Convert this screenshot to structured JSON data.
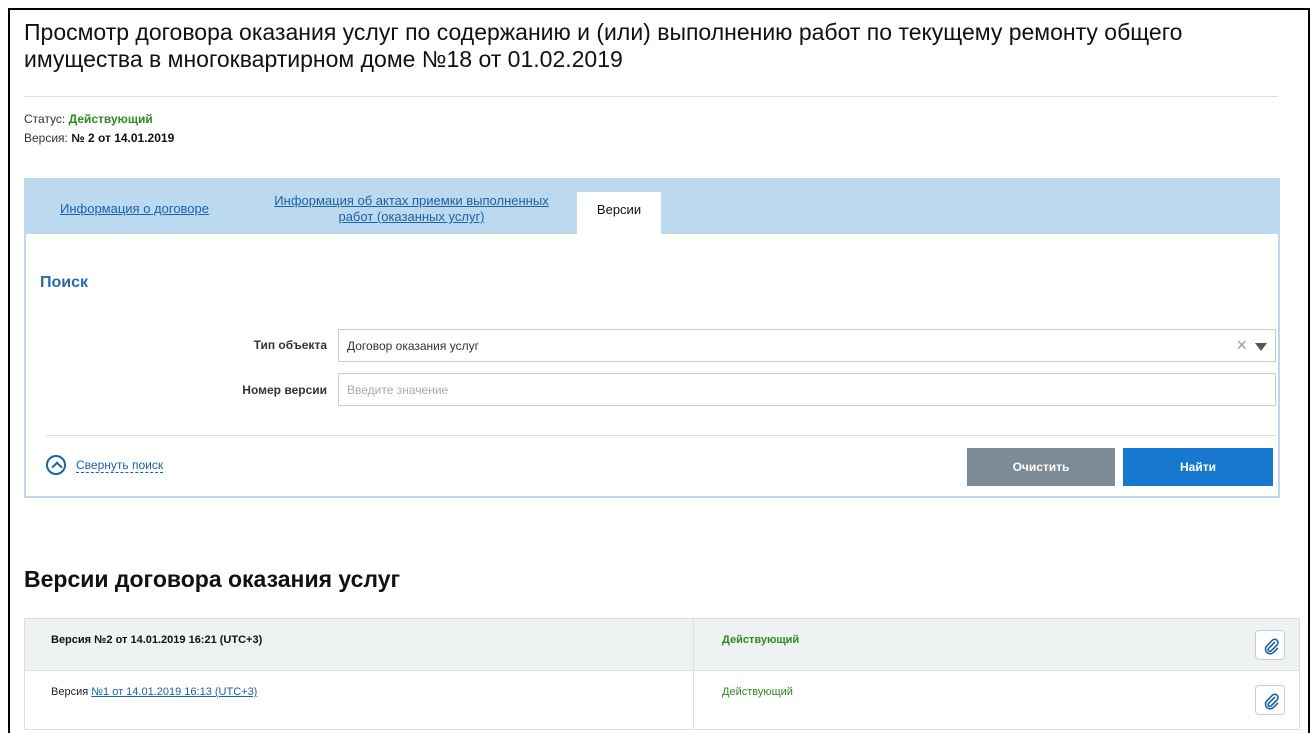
{
  "header": {
    "title": "Просмотр договора оказания услуг по содержанию и (или) выполнению работ по текущему ремонту общего имущества в многоквартирном доме №18 от 01.02.2019"
  },
  "meta": {
    "status_label": "Статус:",
    "status_value": "Действующий",
    "version_label": "Версия:",
    "version_value": "№ 2 от 14.01.2019"
  },
  "tabs": [
    {
      "label": "Информация о договоре",
      "active": false
    },
    {
      "label": "Информация об актах приемки выполненных работ (оказанных услуг)",
      "active": false
    },
    {
      "label": "Версии",
      "active": true
    }
  ],
  "search": {
    "title": "Поиск",
    "object_type_label": "Тип объекта",
    "object_type_value": "Договор оказания услуг",
    "version_number_label": "Номер версии",
    "version_number_placeholder": "Введите значение",
    "collapse_label": "Свернуть поиск",
    "clear_button": "Очистить",
    "find_button": "Найти"
  },
  "versions": {
    "title": "Версии договора оказания услуг",
    "rows": [
      {
        "text": "Версия №2 от 14.01.2019 16:21 (UTC+3)",
        "status": "Действующий"
      },
      {
        "prefix": "Версия ",
        "link": "№1 от 14.01.2019 16:13 (UTC+3)",
        "status": "Действующий"
      }
    ]
  },
  "colors": {
    "accent": "#1778cf",
    "tab_bar": "#bcd9f0",
    "status_green": "#2e8b1f",
    "clear_button": "#7d8b96"
  },
  "icons": {
    "collapse": "chevron-up-circle-icon",
    "clear": "close-icon",
    "dropdown": "caret-down-icon",
    "attachment": "paperclip-icon"
  }
}
